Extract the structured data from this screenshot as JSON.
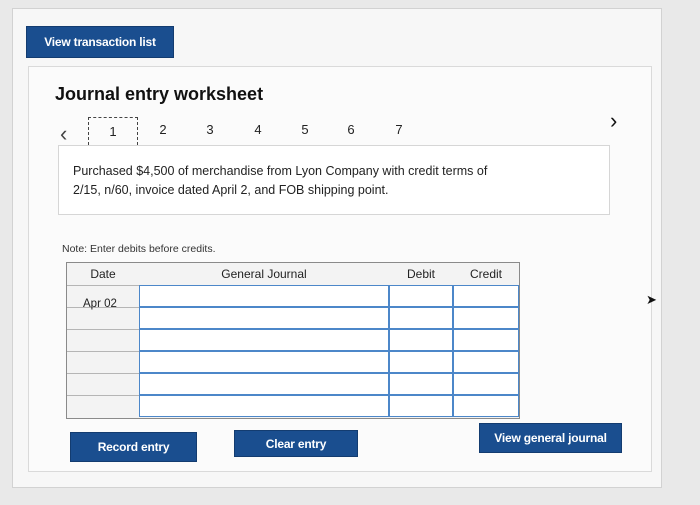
{
  "top_button": "View transaction list",
  "worksheet_title": "Journal entry worksheet",
  "pager": {
    "tabs": [
      "1",
      "2",
      "3",
      "4",
      "5",
      "6",
      "7"
    ],
    "active": "1"
  },
  "description_line1": "Purchased $4,500 of merchandise from Lyon Company with credit terms of",
  "description_line2": "2/15, n/60, invoice dated April 2, and FOB shipping point.",
  "note": "Note: Enter debits before credits.",
  "table": {
    "headers": [
      "Date",
      "General Journal",
      "Debit",
      "Credit"
    ],
    "rows": [
      {
        "date": "Apr 02"
      },
      {
        "date": ""
      },
      {
        "date": ""
      },
      {
        "date": ""
      },
      {
        "date": ""
      },
      {
        "date": ""
      }
    ]
  },
  "buttons": {
    "record": "Record entry",
    "clear": "Clear entry",
    "view_general_journal": "View general journal"
  },
  "colors": {
    "accent": "#1a4e8f",
    "input_border": "#4c87c9"
  },
  "icons": [
    "chevron-left-icon",
    "chevron-right-icon",
    "mouse-cursor-icon"
  ]
}
